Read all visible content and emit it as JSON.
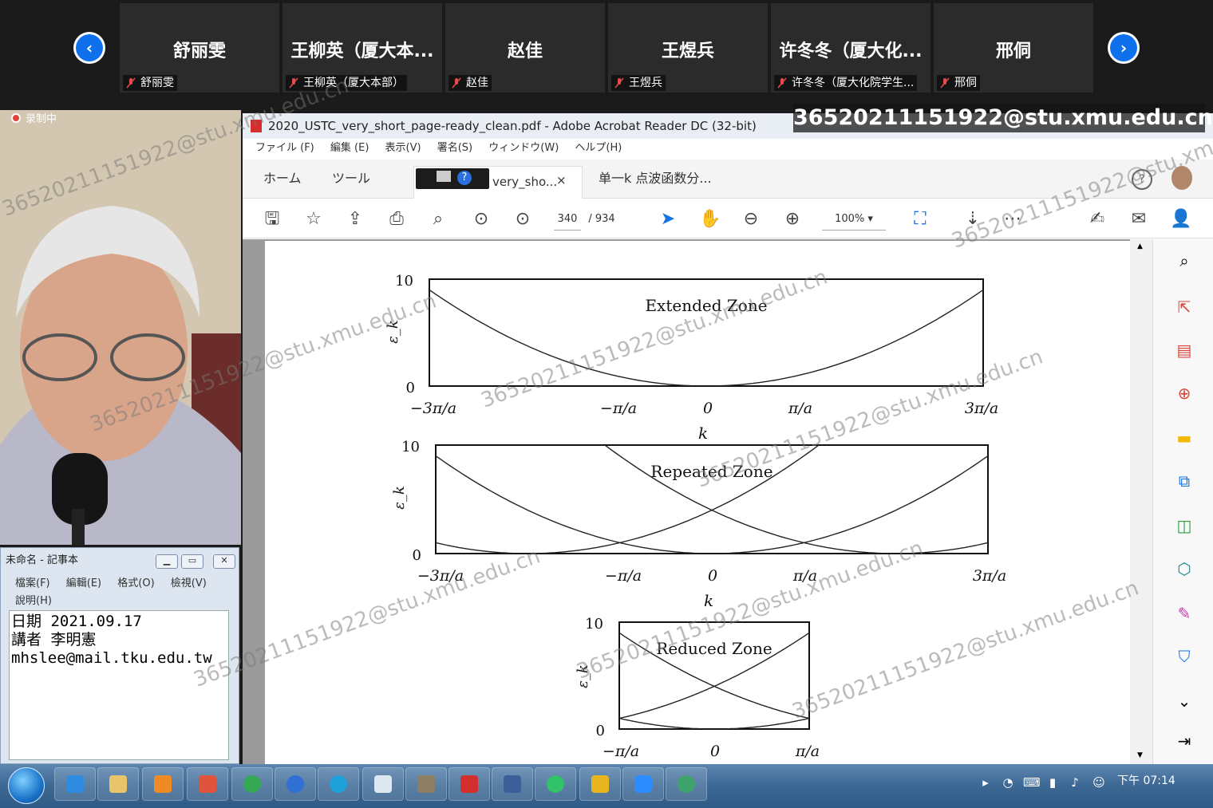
{
  "participants": [
    {
      "name": "舒丽雯",
      "label": "舒丽雯"
    },
    {
      "name": "王柳英（厦大本...",
      "label": "王柳英（厦大本部）"
    },
    {
      "name": "赵佳",
      "label": "赵佳"
    },
    {
      "name": "王煜兵",
      "label": "王煜兵"
    },
    {
      "name": "许冬冬（厦大化...",
      "label": "许冬冬（厦大化院学生..."
    },
    {
      "name": "邢侗",
      "label": "邢侗"
    }
  ],
  "recording": "录制中",
  "email_overlay": "36520211151922@stu.xmu.edu.cn",
  "watermark": "36520211151922@stu.xmu.edu.cn",
  "acrobat": {
    "title": "2020_USTC_very_short_page-ready_clean.pdf - Adobe Acrobat Reader DC (32-bit)",
    "menu": [
      "ファイル (F)",
      "編集 (E)",
      "表示(V)",
      "署名(S)",
      "ウィンドウ(W)",
      "ヘルプ(H)"
    ],
    "tabs": {
      "home": "ホーム",
      "tools": "ツール",
      "doc1": "very_sho...",
      "doc1_close": "×",
      "doc2": "单一k 点波函数分..."
    },
    "page_current": "340",
    "page_total": "/ 934",
    "zoom": "100%"
  },
  "notepad": {
    "title": "未命名 - 記事本",
    "menu": [
      "檔案(F)",
      "編輯(E)",
      "格式(O)",
      "檢視(V)",
      "說明(H)"
    ],
    "lines": [
      "日期 2021.09.17",
      "講者 李明憲",
      "mhslee@mail.tku.edu.tw"
    ]
  },
  "taskbar": {
    "time": "下午 07:14"
  },
  "chart_data": [
    {
      "type": "line",
      "title": "Extended Zone",
      "xlabel": "k",
      "ylabel": "ε_k",
      "x_ticks": [
        "−3π/a",
        "−π/a",
        "0",
        "π/a",
        "3π/a"
      ],
      "y_ticks": [
        "0",
        "10"
      ],
      "ylim": [
        0,
        10
      ],
      "series": [
        {
          "x": [
            -3,
            -2,
            -1,
            0,
            1,
            2,
            3
          ],
          "values": [
            9,
            4,
            1,
            0,
            1,
            4,
            9
          ]
        }
      ]
    },
    {
      "type": "line",
      "title": "Repeated Zone",
      "xlabel": "k",
      "ylabel": "ε_k",
      "x_ticks": [
        "−3π/a",
        "−π/a",
        "0",
        "π/a",
        "3π/a"
      ],
      "y_ticks": [
        "0",
        "10"
      ],
      "ylim": [
        0,
        10
      ],
      "series": [
        {
          "x": [
            -3,
            -2,
            -1,
            0,
            1,
            2,
            3
          ],
          "values": [
            1,
            0,
            1,
            4,
            9,
            16,
            25
          ]
        },
        {
          "x": [
            -3,
            -2,
            -1,
            0,
            1,
            2,
            3
          ],
          "values": [
            9,
            4,
            1,
            0,
            1,
            4,
            9
          ]
        },
        {
          "x": [
            -3,
            -2,
            -1,
            0,
            1,
            2,
            3
          ],
          "values": [
            25,
            16,
            9,
            4,
            1,
            0,
            1
          ]
        }
      ]
    },
    {
      "type": "line",
      "title": "Reduced Zone",
      "xlabel": "",
      "ylabel": "ε_k",
      "x_ticks": [
        "−π/a",
        "0",
        "π/a"
      ],
      "y_ticks": [
        "0",
        "10"
      ],
      "ylim": [
        0,
        10
      ],
      "series": [
        {
          "x": [
            -1,
            -0.5,
            0,
            0.5,
            1
          ],
          "values": [
            1,
            0.25,
            0,
            0.25,
            1
          ]
        },
        {
          "x": [
            -1,
            -0.5,
            0,
            0.5,
            1
          ],
          "values": [
            9,
            6.25,
            4,
            2.25,
            1
          ]
        },
        {
          "x": [
            -1,
            -0.5,
            0,
            0.5,
            1
          ],
          "values": [
            1,
            2.25,
            4,
            6.25,
            9
          ]
        }
      ]
    }
  ]
}
